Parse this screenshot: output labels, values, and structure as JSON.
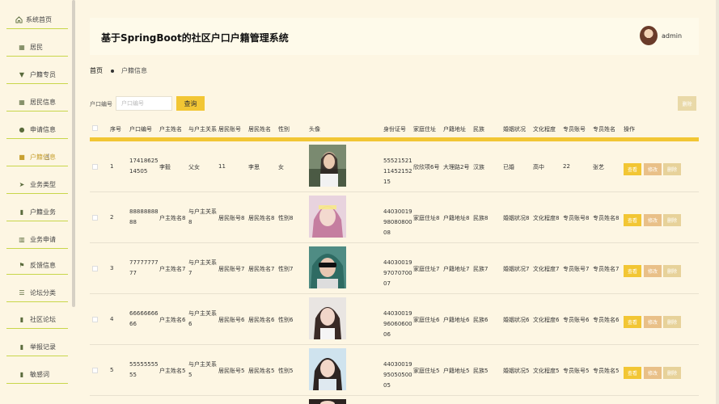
{
  "sidebar": {
    "items": [
      {
        "label": "系统首页",
        "icon": "home-icon"
      },
      {
        "label": "居民",
        "icon": "grid-icon"
      },
      {
        "label": "户籍专员",
        "icon": "flag-icon"
      },
      {
        "label": "居民信息",
        "icon": "grid-icon"
      },
      {
        "label": "申请信息",
        "icon": "user-icon"
      },
      {
        "label": "户籍信息",
        "icon": "briefcase-icon"
      },
      {
        "label": "业务类型",
        "icon": "send-icon"
      },
      {
        "label": "户籍业务",
        "icon": "book-icon"
      },
      {
        "label": "业务申请",
        "icon": "bar-chart-icon"
      },
      {
        "label": "反馈信息",
        "icon": "flag-icon"
      },
      {
        "label": "论坛分类",
        "icon": "list-icon"
      },
      {
        "label": "社区论坛",
        "icon": "book-icon"
      },
      {
        "label": "举报记录",
        "icon": "book-icon"
      },
      {
        "label": "敏感词",
        "icon": "book-icon"
      }
    ]
  },
  "header": {
    "title": "基于SpringBoot的社区户口户籍管理系统",
    "username": "admin"
  },
  "breadcrumb": {
    "home": "首页",
    "current": "户籍信息"
  },
  "search": {
    "label": "户口编号",
    "placeholder": "户口编号",
    "query_label": "查询",
    "delete_label": "删除"
  },
  "table": {
    "columns": [
      "序号",
      "户口编号",
      "户主姓名",
      "与户主关系",
      "居民账号",
      "居民姓名",
      "性别",
      "头像",
      "身份证号",
      "家庭住址",
      "户籍地址",
      "民族",
      "婚姻状况",
      "文化程度",
      "专员账号",
      "专员姓名",
      "操作"
    ],
    "actions": {
      "view": "查看",
      "edit": "修改",
      "delete": "删除"
    },
    "rows": [
      {
        "idx": "1",
        "hukou": "1741862514505",
        "huzhu": "李毅",
        "relation": "父女",
        "account": "11",
        "name": "李思",
        "gender": "女",
        "idcard": "555215211145215215",
        "home_addr": "欣欣项6号",
        "reg_addr": "大理路2号",
        "ethnic": "汉族",
        "marital": "已婚",
        "edu": "高中",
        "staff_acc": "22",
        "staff_name": "张艺"
      },
      {
        "idx": "2",
        "hukou": "8888888888",
        "huzhu": "户主姓名8",
        "relation": "与户主关系8",
        "account": "居民账号8",
        "name": "居民姓名8",
        "gender": "性别8",
        "idcard": "440300199808080008",
        "home_addr": "家庭住址8",
        "reg_addr": "户籍地址8",
        "ethnic": "民族8",
        "marital": "婚姻状况8",
        "edu": "文化程度8",
        "staff_acc": "专员账号8",
        "staff_name": "专员姓名8"
      },
      {
        "idx": "3",
        "hukou": "7777777777",
        "huzhu": "户主姓名7",
        "relation": "与户主关系7",
        "account": "居民账号7",
        "name": "居民姓名7",
        "gender": "性别7",
        "idcard": "440300199707070007",
        "home_addr": "家庭住址7",
        "reg_addr": "户籍地址7",
        "ethnic": "民族7",
        "marital": "婚姻状况7",
        "edu": "文化程度7",
        "staff_acc": "专员账号7",
        "staff_name": "专员姓名7"
      },
      {
        "idx": "4",
        "hukou": "6666666666",
        "huzhu": "户主姓名6",
        "relation": "与户主关系6",
        "account": "居民账号6",
        "name": "居民姓名6",
        "gender": "性别6",
        "idcard": "440300199606060006",
        "home_addr": "家庭住址6",
        "reg_addr": "户籍地址6",
        "ethnic": "民族6",
        "marital": "婚姻状况6",
        "edu": "文化程度6",
        "staff_acc": "专员账号6",
        "staff_name": "专员姓名6"
      },
      {
        "idx": "5",
        "hukou": "5555555555",
        "huzhu": "户主姓名5",
        "relation": "与户主关系5",
        "account": "居民账号5",
        "name": "居民姓名5",
        "gender": "性别5",
        "idcard": "440300199505050005",
        "home_addr": "家庭住址5",
        "reg_addr": "户籍地址5",
        "ethnic": "民族5",
        "marital": "婚姻状况5",
        "edu": "文化程度5",
        "staff_acc": "专员账号5",
        "staff_name": "专员姓名5"
      }
    ]
  },
  "colors": {
    "accent": "#f2c634",
    "edit": "#e9c088",
    "delete": "#e7d29a",
    "background": "#fdf6e3"
  }
}
